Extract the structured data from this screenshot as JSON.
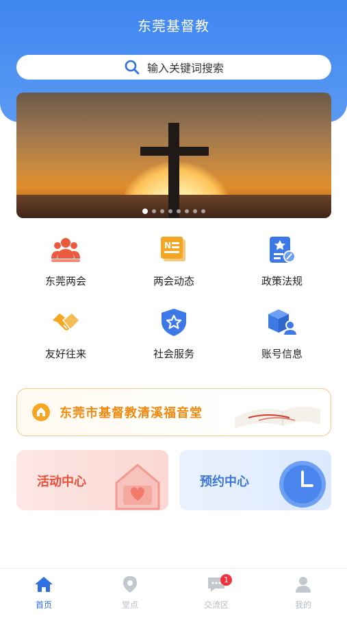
{
  "header": {
    "title": "东莞基督教"
  },
  "search": {
    "placeholder": "输入关键词搜索"
  },
  "banner": {
    "slide_count": 8,
    "active_index": 0
  },
  "menu": [
    {
      "label": "东莞两会",
      "icon": "group-icon"
    },
    {
      "label": "两会动态",
      "icon": "news-icon"
    },
    {
      "label": "政策法规",
      "icon": "policy-icon"
    },
    {
      "label": "友好往来",
      "icon": "handshake-icon"
    },
    {
      "label": "社会服务",
      "icon": "shield-star-icon"
    },
    {
      "label": "账号信息",
      "icon": "account-box-icon"
    }
  ],
  "notice": {
    "text": "东莞市基督教清溪福音堂"
  },
  "cards": {
    "activity": "活动中心",
    "booking": "预约中心"
  },
  "tabbar": {
    "home": "首页",
    "venues": "堂点",
    "community": "交流区",
    "community_badge": "1",
    "mine": "我的"
  },
  "colors": {
    "primary": "#3f86f0",
    "accent_orange": "#f5a623",
    "activity_red": "#e9503a",
    "booking_blue": "#3d74d8"
  }
}
